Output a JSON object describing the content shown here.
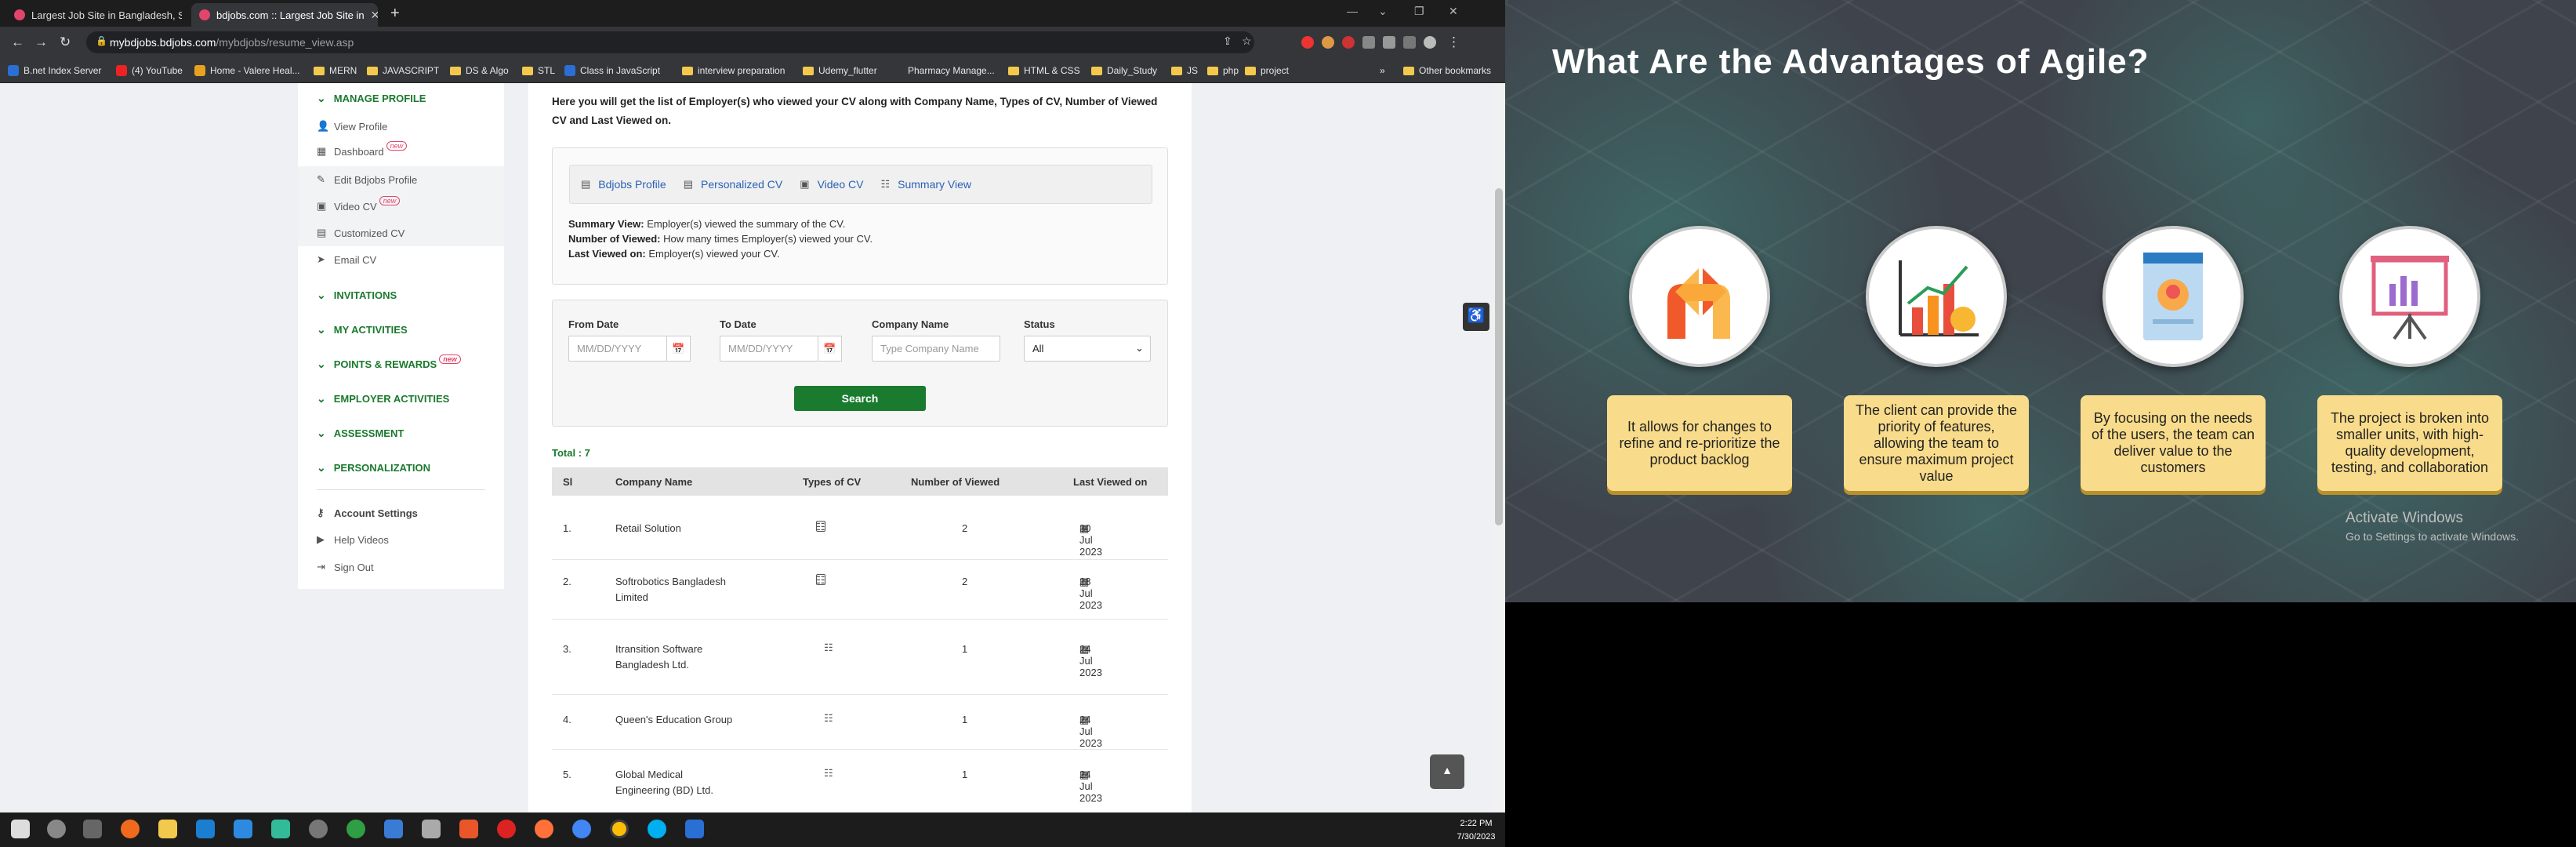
{
  "browser": {
    "tabs": [
      {
        "title": "Largest Job Site in Bangladesh, S",
        "active": false
      },
      {
        "title": "bdjobs.com :: Largest Job Site in",
        "active": true
      }
    ],
    "url_domain": "mybdjobs.bdjobs.com",
    "url_path": "/mybdjobs/resume_view.asp",
    "bookmarks": [
      {
        "label": "B.net Index Server",
        "type": "site"
      },
      {
        "label": "(4) YouTube",
        "type": "site"
      },
      {
        "label": "Home - Valere Heal...",
        "type": "site"
      },
      {
        "label": "MERN",
        "type": "folder"
      },
      {
        "label": "JAVASCRIPT",
        "type": "folder"
      },
      {
        "label": "DS & Algo",
        "type": "folder"
      },
      {
        "label": "STL",
        "type": "folder"
      },
      {
        "label": "Class in JavaScript",
        "type": "site"
      },
      {
        "label": "interview preparation",
        "type": "folder"
      },
      {
        "label": "Udemy_flutter",
        "type": "folder"
      },
      {
        "label": "Pharmacy Manage...",
        "type": "site"
      },
      {
        "label": "HTML & CSS",
        "type": "folder"
      },
      {
        "label": "Daily_Study",
        "type": "folder"
      },
      {
        "label": "JS",
        "type": "folder"
      },
      {
        "label": "php",
        "type": "folder"
      },
      {
        "label": "project",
        "type": "folder"
      }
    ],
    "other_bookmarks": "Other bookmarks"
  },
  "sidebar": {
    "manage_profile": "MANAGE PROFILE",
    "items": [
      {
        "label": "View Profile",
        "icon": "person-icon",
        "new": false
      },
      {
        "label": "Dashboard",
        "icon": "dashboard-icon",
        "new": true
      },
      {
        "label": "Edit Bdjobs Profile",
        "icon": "edit-icon",
        "new": false
      },
      {
        "label": "Video CV",
        "icon": "video-icon",
        "new": true
      },
      {
        "label": "Customized CV",
        "icon": "document-icon",
        "new": false
      },
      {
        "label": "Email CV",
        "icon": "send-icon",
        "new": false
      }
    ],
    "new_badge": "new",
    "sections": [
      "INVITATIONS",
      "MY ACTIVITIES",
      "POINTS & REWARDS",
      "EMPLOYER ACTIVITIES",
      "ASSESSMENT",
      "PERSONALIZATION"
    ],
    "bottom": [
      {
        "label": "Account Settings",
        "icon": "key-icon"
      },
      {
        "label": "Help Videos",
        "icon": "play-icon"
      },
      {
        "label": "Sign Out",
        "icon": "sign-out-icon"
      }
    ]
  },
  "main": {
    "intro": "Here you will get the list of Employer(s) who viewed your CV along with Company Name, Types of CV, Number of Viewed CV and Last Viewed on.",
    "cv_types": [
      "Bdjobs Profile",
      "Personalized CV",
      "Video CV",
      "Summary View"
    ],
    "definitions": [
      {
        "term": "Summary View:",
        "text": "Employer(s) viewed the summary of the CV."
      },
      {
        "term": "Number of Viewed:",
        "text": "How many times Employer(s) viewed your CV."
      },
      {
        "term": "Last Viewed on:",
        "text": "Employer(s) viewed your CV."
      }
    ],
    "filters": {
      "from_date_label": "From Date",
      "to_date_label": "To Date",
      "company_label": "Company Name",
      "status_label": "Status",
      "date_placeholder": "MM/DD/YYYY",
      "company_placeholder": "Type Company Name",
      "status_value": "All",
      "search_label": "Search"
    },
    "total": "Total : 7",
    "table": {
      "headers": [
        "Sl",
        "Company Name",
        "Types of CV",
        "Number of Viewed",
        "Last Viewed on"
      ],
      "rows": [
        {
          "sl": "1.",
          "company": "Retail Solution",
          "company2": "",
          "types": [
            "document",
            "summary"
          ],
          "viewed": "2",
          "date": "30 Jul 2023"
        },
        {
          "sl": "2.",
          "company": "Softrobotics Bangladesh",
          "company2": "Limited",
          "types": [
            "document",
            "summary"
          ],
          "viewed": "2",
          "date": "28 Jul 2023"
        },
        {
          "sl": "3.",
          "company": "Itransition Software",
          "company2": "Bangladesh Ltd.",
          "types": [
            "summary"
          ],
          "viewed": "1",
          "date": "24 Jul 2023"
        },
        {
          "sl": "4.",
          "company": "Queen's Education Group",
          "company2": "",
          "types": [
            "summary"
          ],
          "viewed": "1",
          "date": "24 Jul 2023"
        },
        {
          "sl": "5.",
          "company": "Global Medical",
          "company2": "Engineering (BD) Ltd.",
          "types": [
            "summary"
          ],
          "viewed": "1",
          "date": "24 Jul 2023"
        }
      ]
    }
  },
  "taskbar": {
    "time": "2:22 PM",
    "date": "7/30/2023"
  },
  "slide": {
    "title": "What Are the Advantages of Agile?",
    "cards": [
      "It allows for changes to refine and re-prioritize the product backlog",
      "The client can provide the priority of features, allowing the team to ensure maximum project value",
      "By focusing on the needs of the users, the team can deliver value to the customers",
      "The project is broken into smaller units, with high-quality development, testing, and collaboration"
    ],
    "watermark": "Activate Windows",
    "watermark_sub": "Go to Settings to activate Windows."
  }
}
